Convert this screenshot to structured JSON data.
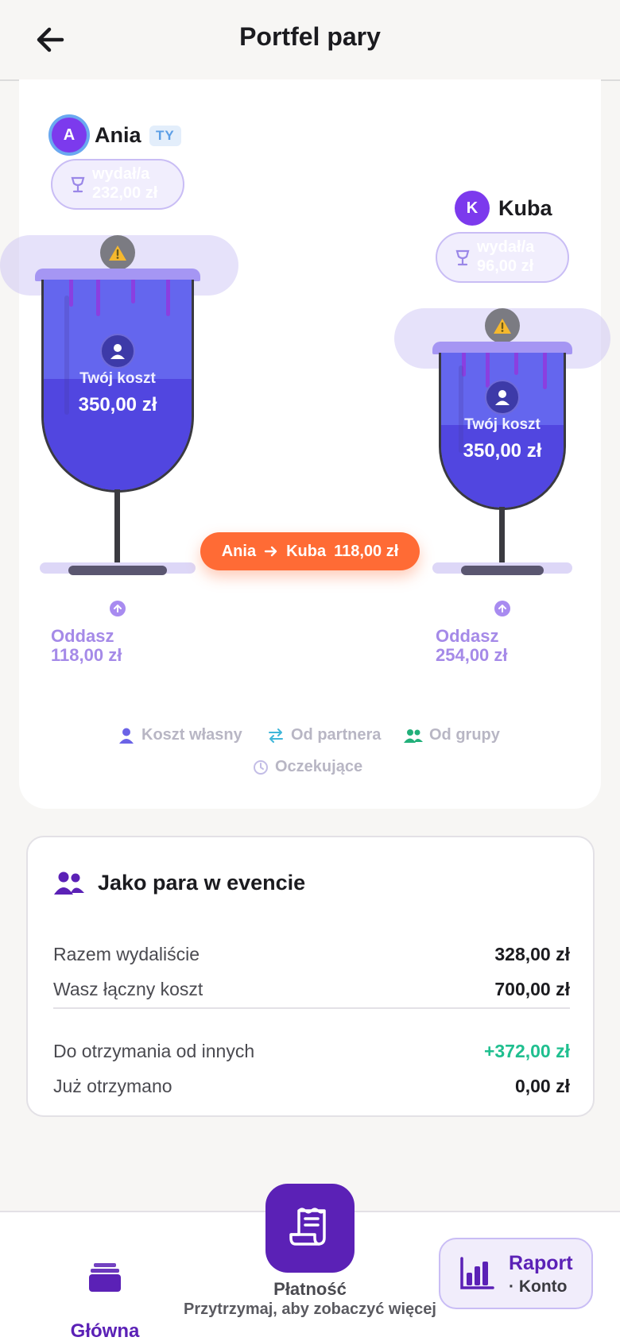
{
  "header": {
    "title": "Portfel pary"
  },
  "people": [
    {
      "initial": "A",
      "name": "Ania",
      "you_badge": "TY",
      "spent_label": "wydał/a",
      "spent_amount": "232,00 zł",
      "cost_label": "Twój koszt",
      "cost_value": "350,00 zł",
      "owe_label": "Oddasz",
      "owe_amount": "118,00 zł"
    },
    {
      "initial": "K",
      "name": "Kuba",
      "spent_label": "wydał/a",
      "spent_amount": "96,00 zł",
      "cost_label": "Twój koszt",
      "cost_value": "350,00 zł",
      "owe_label": "Oddasz",
      "owe_amount": "254,00 zł"
    }
  ],
  "transfer": {
    "from": "Ania",
    "to": "Kuba",
    "amount": "118,00 zł"
  },
  "legend": [
    {
      "icon": "person-icon",
      "label": "Koszt własny",
      "color": "#6b63e6"
    },
    {
      "icon": "swap-icon",
      "label": "Od partnera",
      "color": "#3fb6d9"
    },
    {
      "icon": "group-icon",
      "label": "Od grupy",
      "color": "#22b07a"
    },
    {
      "icon": "clock-icon",
      "label": "Oczekujące",
      "color": "#c3bde6"
    }
  ],
  "summary": {
    "icon": "couple-icon",
    "title": "Jako para w evencie",
    "rows": [
      {
        "label": "Razem wydaliście",
        "value": "328,00 zł"
      },
      {
        "label": "Wasz łączny koszt",
        "value": "700,00 zł"
      },
      {
        "label": "Do otrzymania od innych",
        "value": "+372,00 zł"
      },
      {
        "label": "Już otrzymano",
        "value": "0,00 zł"
      }
    ]
  },
  "nav": {
    "home_label": "Główna",
    "pay_label": "Płatność",
    "pay_hint": "Przytrzymaj, aby zobaczyć więcej",
    "report_label": "Raport",
    "report_sub": "· Konto"
  },
  "colors": {
    "accent": "#5b21b6",
    "transfer": "#ff6b35",
    "positive": "#1fbf8f",
    "glass_fill": "#6466ee"
  }
}
